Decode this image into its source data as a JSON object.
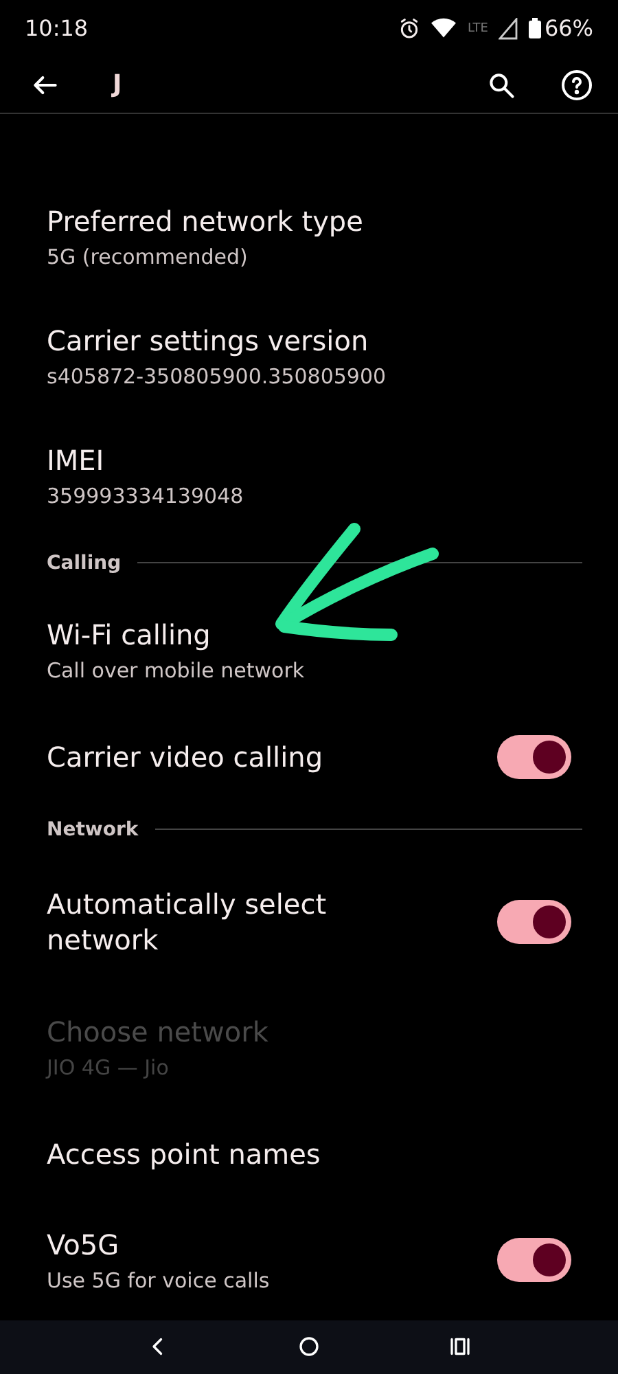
{
  "status_bar": {
    "time": "10:18",
    "network_label": "LTE",
    "battery": "66%"
  },
  "app_bar": {
    "title": "J"
  },
  "items": [
    {
      "kind": "preference",
      "title": "Preferred network type",
      "summary": "5G (recommended)",
      "disabled": false
    },
    {
      "kind": "preference",
      "title": "Carrier settings version",
      "summary": "s405872-350805900.350805900",
      "disabled": false
    },
    {
      "kind": "preference",
      "title": "IMEI",
      "summary": "359993334139048",
      "disabled": false
    },
    {
      "kind": "header",
      "title": "Calling"
    },
    {
      "kind": "preference",
      "title": "Wi-Fi calling",
      "summary": "Call over mobile network",
      "disabled": false
    },
    {
      "kind": "switch",
      "title": "Carrier video calling",
      "on": true,
      "disabled": false
    },
    {
      "kind": "header",
      "title": "Network"
    },
    {
      "kind": "switch",
      "title": "Automatically select network",
      "on": true,
      "disabled": false
    },
    {
      "kind": "preference",
      "title": "Choose network",
      "summary": "JIO 4G — Jio",
      "disabled": true
    },
    {
      "kind": "preference",
      "title": "Access point names",
      "disabled": false
    },
    {
      "kind": "switch",
      "title": "Vo5G",
      "summary": "Use 5G for voice calls",
      "on": true,
      "disabled": false
    }
  ]
}
